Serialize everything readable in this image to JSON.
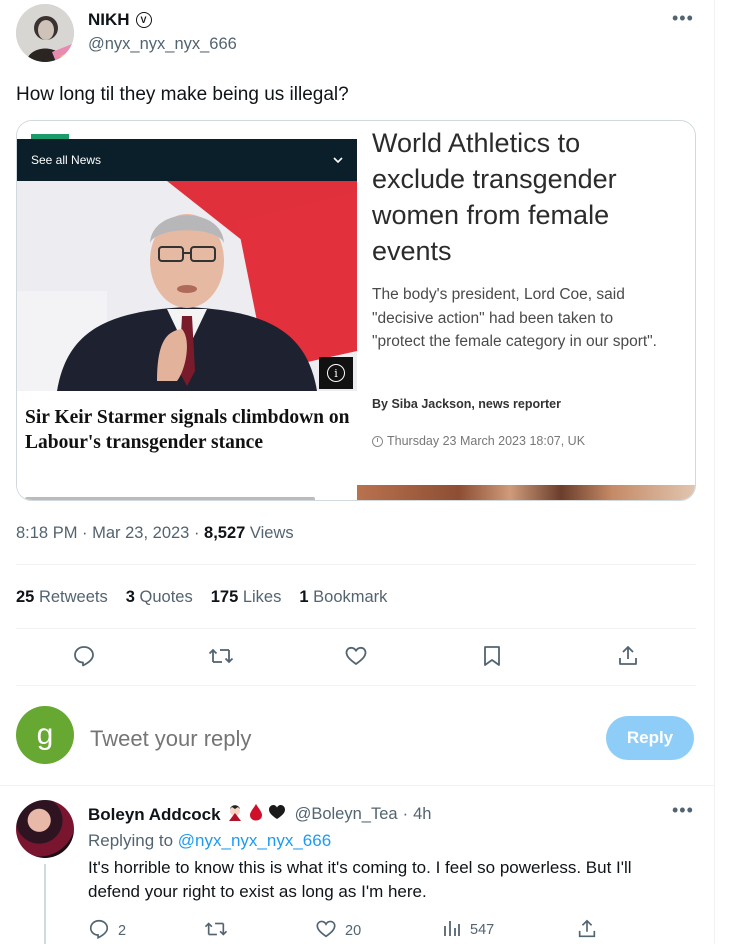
{
  "author": {
    "display_name": "NIKH",
    "handle": "@nyx_nyx_nyx_666",
    "verified_badge": "circled-v-icon"
  },
  "tweet": {
    "text": "How long til they make being us illegal?"
  },
  "card": {
    "left": {
      "nav_label": "See all News",
      "headline": "Sir Keir Starmer signals climbdown on Labour's transgender stance"
    },
    "right": {
      "headline": "World Athletics to exclude transgender women from female events",
      "standfirst": "The body's president, Lord Coe, said \"decisive action\" had been taken to \"protect the female category in our sport\".",
      "byline": "By Siba Jackson, news reporter",
      "dateline": "Thursday 23 March 2023 18:07, UK"
    }
  },
  "meta": {
    "time": "8:18 PM",
    "date": "Mar 23, 2023",
    "views_count": "8,527",
    "views_label": "Views"
  },
  "stats": [
    {
      "count": "25",
      "label": "Retweets"
    },
    {
      "count": "3",
      "label": "Quotes"
    },
    {
      "count": "175",
      "label": "Likes"
    },
    {
      "count": "1",
      "label": "Bookmark"
    }
  ],
  "composer": {
    "avatar_letter": "g",
    "placeholder": "Tweet your reply",
    "reply_label": "Reply"
  },
  "reply": {
    "name": "Boleyn Addcock",
    "handle": "@Boleyn_Tea",
    "age": "4h",
    "emojis": [
      "vampire-emoji",
      "drop-of-blood-emoji",
      "black-heart-emoji"
    ],
    "replying_prefix": "Replying to",
    "replying_to": "@nyx_nyx_nyx_666",
    "text": "It's horrible to know this is what it's coming to. I feel so powerless. But I'll defend your right to exist as long as I'm here.",
    "replies": "2",
    "likes": "20",
    "views": "547"
  },
  "colors": {
    "accent": "#1d9bf0",
    "reply_button": "#8ecdf8",
    "muted_text": "#536471",
    "composer_avatar": "#66a832",
    "news_bar": "#0b1f2a"
  }
}
